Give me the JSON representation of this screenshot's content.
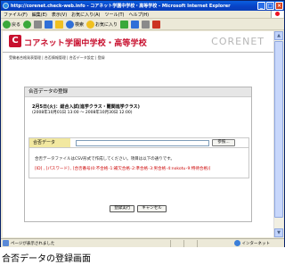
{
  "window": {
    "title": "http://corenet.check-web.info - コアネット学園中学校・高等学校 - Microsoft Internet Explorer",
    "controls": [
      "minimize-icon",
      "maximize-icon",
      "close-icon"
    ]
  },
  "menubar": {
    "items": [
      "ファイル(F)",
      "編集(E)",
      "表示(V)",
      "お気に入り(A)",
      "ツール(T)",
      "ヘルプ(H)"
    ]
  },
  "toolbar": {
    "back_label": "戻る",
    "search_label": "検索",
    "favorites_label": "お気に入り"
  },
  "site": {
    "logo_glyph": "C",
    "name": "コアネット学園中学校・高等学校",
    "brand": "CORENET",
    "breadcrumb": "受験者合格発表管理 | 合否情報管理 | 合否データ設定 | 登録"
  },
  "form": {
    "heading": "合否データの登録",
    "event_title": "2月5日(火)：総合入試(進学クラス・難関進学クラス)",
    "event_period": "(2008年10月01日 13:00 〜 2008年10月30日 12:00)",
    "upload_label": "合否データ",
    "browse_label": "参照...",
    "note": "合否データファイルはCSV形式で作成してください。項目は以下の通りです。",
    "format": "[ID] , [パスワード] , [合否番号(0:不合格･1:補欠合格･2:準合格･3:男合格･4:nokotu･9:特待合格)]",
    "submit_label": "登録実行",
    "cancel_label": "キャンセル"
  },
  "statusbar": {
    "text": "ページが表示されました",
    "zone": "インターネット"
  },
  "caption": "合否データの登録画面",
  "colors": {
    "brand_red": "#c8102e",
    "upload_label_bg": "#f2e8a0",
    "format_text": "#cc0000"
  }
}
